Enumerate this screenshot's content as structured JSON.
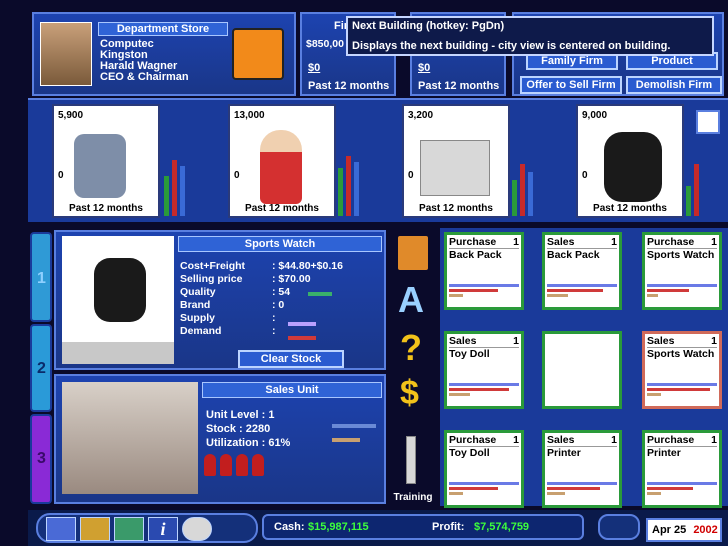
{
  "firm": {
    "dept": "Department Store",
    "lines": [
      "Computec",
      "Kingston",
      "Harald Wagner",
      "CEO & Chairman"
    ]
  },
  "top": {
    "firm_label": "Firm",
    "firm_value": "$850,00",
    "val1": "$0",
    "val2": "$0",
    "past1": "Past 12 months",
    "past2": "Past 12 months",
    "offer": "Offer to Sell Firm",
    "demolish": "Demolish Firm",
    "btn_hidden_1": "Family Firm",
    "btn_hidden_2": "Product"
  },
  "tooltip": {
    "title": "Next Building (hotkey: PgDn)",
    "desc": "Displays the next building - city view is centered on building."
  },
  "products": [
    {
      "num": "5,900",
      "zero": "0",
      "cap": "Past 12 months",
      "icon": "backpack-icon"
    },
    {
      "num": "13,000",
      "zero": "0",
      "cap": "Past 12 months",
      "icon": "doll-icon"
    },
    {
      "num": "3,200",
      "zero": "0",
      "cap": "Past 12 months",
      "icon": "printer-icon"
    },
    {
      "num": "9,000",
      "zero": "0",
      "cap": "Past 12 months",
      "icon": "watch-icon"
    }
  ],
  "product_info": {
    "title": "Sports Watch",
    "rows": [
      {
        "l": "Cost+Freight",
        "v": ": $44.80+$0.16"
      },
      {
        "l": "Selling price",
        "v": ": $70.00"
      },
      {
        "l": "Quality",
        "v": ": 54"
      },
      {
        "l": "Brand",
        "v": ": 0"
      },
      {
        "l": "Supply",
        "v": ":"
      },
      {
        "l": "Demand",
        "v": ":"
      }
    ],
    "clear": "Clear Stock"
  },
  "unit": {
    "title": "Sales Unit",
    "level": "Unit Level : 1",
    "stock": "Stock : 2280",
    "util": "Utilization : 61%"
  },
  "side_tabs": [
    "1",
    "2",
    "3"
  ],
  "toolbar": {
    "training": "Training"
  },
  "tiles": [
    {
      "type": "Purchase",
      "n": "1",
      "name": "Back Pack"
    },
    {
      "type": "Sales",
      "n": "1",
      "name": "Back Pack"
    },
    {
      "type": "Purchase",
      "n": "1",
      "name": "Sports Watch"
    },
    {
      "type": "Sales",
      "n": "1",
      "name": "Toy Doll"
    },
    {
      "type": "",
      "n": "",
      "name": ""
    },
    {
      "type": "Sales",
      "n": "1",
      "name": "Sports Watch"
    },
    {
      "type": "Purchase",
      "n": "1",
      "name": "Toy Doll"
    },
    {
      "type": "Sales",
      "n": "1",
      "name": "Printer"
    },
    {
      "type": "Purchase",
      "n": "1",
      "name": "Printer"
    }
  ],
  "status": {
    "cash_label": "Cash:",
    "cash": "$15,987,115",
    "profit_label": "Profit:",
    "profit": "$7,574,759",
    "date": "Apr 25",
    "year": "2002"
  },
  "colors": {
    "accent_green": "#3cff3c",
    "year_red": "#d00000"
  }
}
